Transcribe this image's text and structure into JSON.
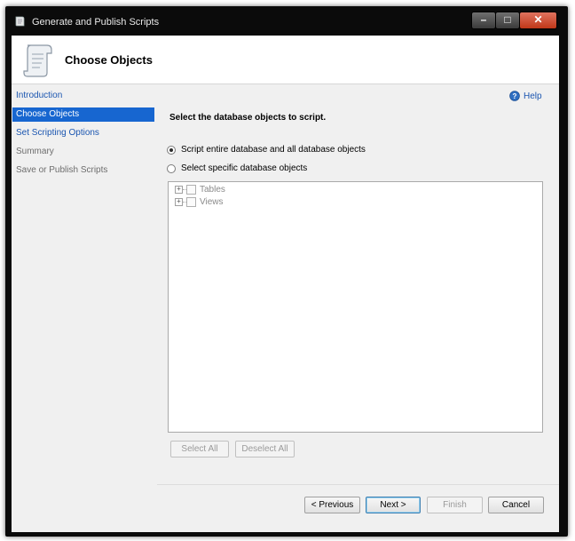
{
  "window": {
    "title": "Generate and Publish Scripts"
  },
  "header": {
    "title": "Choose Objects"
  },
  "nav": {
    "items": [
      {
        "label": "Introduction",
        "state": "link"
      },
      {
        "label": "Choose Objects",
        "state": "selected"
      },
      {
        "label": "Set Scripting Options",
        "state": "link"
      },
      {
        "label": "Summary",
        "state": "disabled"
      },
      {
        "label": "Save or Publish Scripts",
        "state": "disabled"
      }
    ]
  },
  "main": {
    "help_label": "Help",
    "prompt": "Select the database objects to script.",
    "radio_entire": "Script entire database and all database objects",
    "radio_specific": "Select specific database objects",
    "selected_option": "entire",
    "tree": [
      {
        "label": "Tables"
      },
      {
        "label": "Views"
      }
    ],
    "select_all_label": "Select All",
    "deselect_all_label": "Deselect All"
  },
  "footer": {
    "previous_label": "< Previous",
    "next_label": "Next >",
    "finish_label": "Finish",
    "cancel_label": "Cancel"
  },
  "colors": {
    "selection": "#1766d0",
    "link": "#1a55b0",
    "titlebar": "#0b0b0b",
    "close_button": "#c03718"
  }
}
